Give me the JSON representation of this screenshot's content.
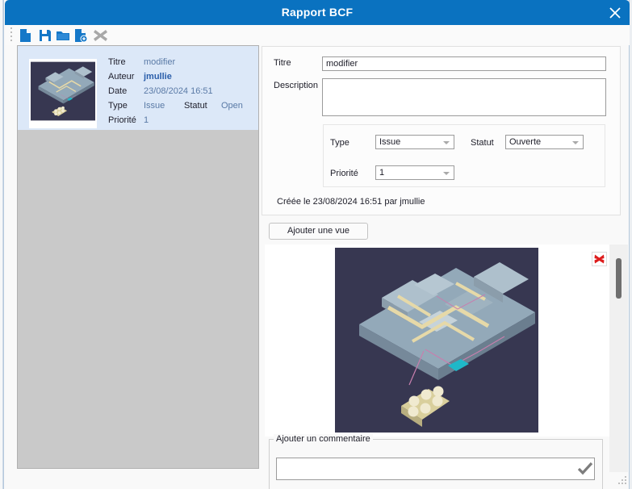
{
  "window": {
    "title": "Rapport BCF",
    "close_icon": "close-icon"
  },
  "toolbar": {
    "items": [
      {
        "icon": "new-file-icon"
      },
      {
        "icon": "save-icon"
      },
      {
        "icon": "open-folder-icon"
      },
      {
        "icon": "save-as-icon"
      },
      {
        "icon": "delete-icon"
      }
    ]
  },
  "issue_list": {
    "items": [
      {
        "thumbnail_icon": "bcf-viewpoint-thumbnail",
        "fields": [
          {
            "label": "Titre",
            "value": "modifier"
          },
          {
            "label": "Auteur",
            "value": "jmullie"
          },
          {
            "label": "Date",
            "value": "23/08/2024 16:51"
          },
          {
            "label": "Type",
            "value": "Issue",
            "label2": "Statut",
            "value2": "Open"
          },
          {
            "label": "Priorité",
            "value": "1"
          }
        ]
      }
    ]
  },
  "details": {
    "titre_label": "Titre",
    "titre_value": "modifier",
    "titre_placeholder": "",
    "description_label": "Description",
    "description_value": "",
    "description_placeholder": "",
    "type_label": "Type",
    "type_value": "Issue",
    "statut_label": "Statut",
    "statut_value": "Ouverte",
    "priorite_label": "Priorité",
    "priorite_value": "1",
    "created_text": "Créée le 23/08/2024 16:51 par jmullie",
    "add_view_button": "Ajouter une vue"
  },
  "viewport": {
    "image_icon": "bcf-viewpoint-image",
    "delete_icon": "delete-view-icon",
    "scrollbar_icon": "vertical-scrollbar"
  },
  "comment": {
    "legend": "Ajouter un commentaire",
    "value": "",
    "placeholder": "",
    "submit_icon": "check-icon"
  },
  "status": {
    "resize_grip_icon": "resize-grip-icon"
  },
  "colors": {
    "title_bar": "#0a72c0",
    "icon_blue": "#1578c8",
    "icon_gray": "#a8a8a8",
    "selected_item": "#dce8f8",
    "list_background": "#c9c9c9",
    "link_text": "#5a7aa6",
    "author_text": "#2a5eaa",
    "delete_red": "#dd1c1c",
    "viewpoint_background": "#373751"
  }
}
